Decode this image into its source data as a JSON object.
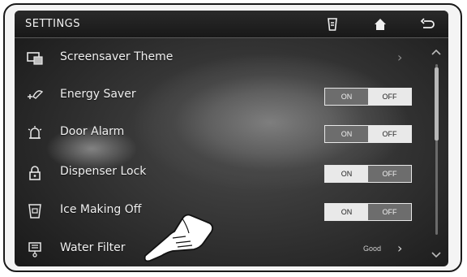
{
  "header": {
    "title": "SETTINGS"
  },
  "settings": [
    {
      "label": "Screensaver Theme"
    },
    {
      "label": "Energy Saver",
      "on_label": "ON",
      "off_label": "OFF",
      "selected": "OFF"
    },
    {
      "label": "Door Alarm",
      "on_label": "ON",
      "off_label": "OFF",
      "selected": "OFF"
    },
    {
      "label": "Dispenser Lock",
      "on_label": "ON",
      "off_label": "OFF",
      "selected": "ON"
    },
    {
      "label": "Ice Making Off",
      "on_label": "ON",
      "off_label": "OFF",
      "selected": "ON"
    },
    {
      "label": "Water Filter",
      "status": "Good"
    }
  ],
  "icons": {
    "header": [
      "cup-icon",
      "home-icon",
      "back-icon"
    ],
    "rows": [
      "screensaver-icon",
      "energy-saver-icon",
      "door-alarm-icon",
      "lock-icon",
      "ice-making-icon",
      "water-filter-icon"
    ]
  }
}
